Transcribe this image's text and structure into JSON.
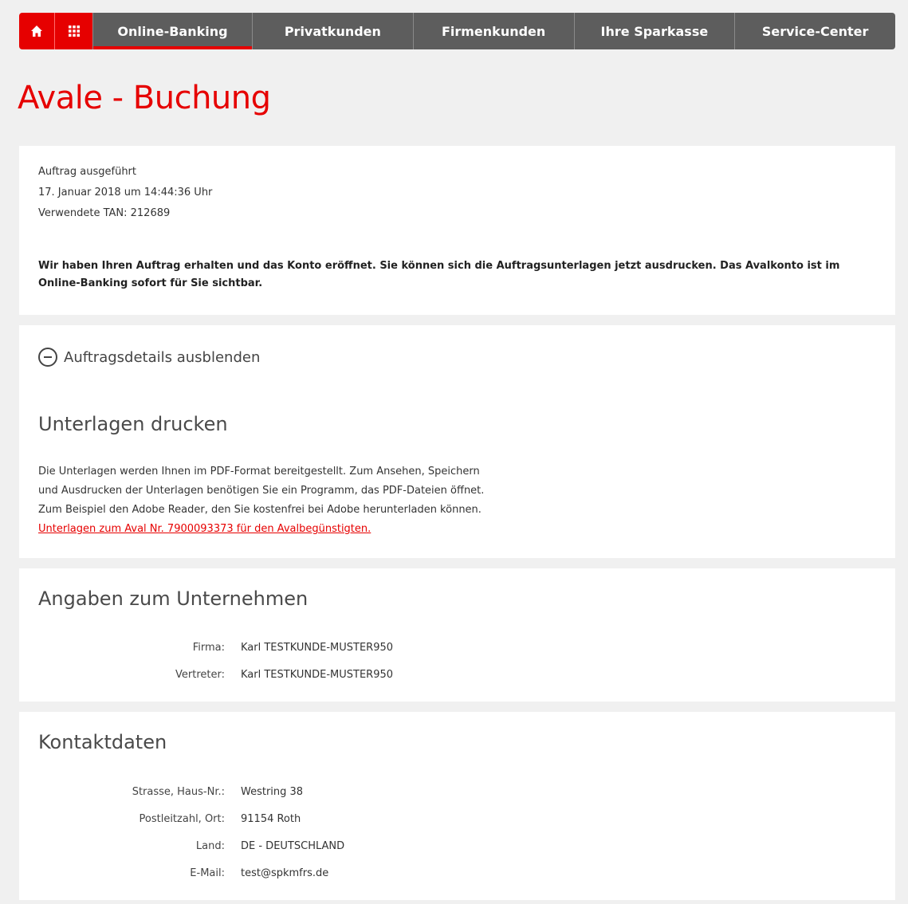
{
  "nav": {
    "home_icon": "home-icon",
    "grid_icon": "apps-grid-icon",
    "tabs": [
      "Online-Banking",
      "Privatkunden",
      "Firmenkunden",
      "Ihre Sparkasse",
      "Service-Center"
    ],
    "active_tab": "Online-Banking",
    "accent": "#e60000",
    "tab_bg": "#5d5d5d"
  },
  "page": {
    "title": "Avale - Buchung"
  },
  "status": {
    "line1": "Auftrag ausgeführt",
    "line2": "17. Januar 2018 um 14:44:36 Uhr",
    "line3": "Verwendete TAN: 212689",
    "notice": "Wir haben Ihren Auftrag erhalten und das Konto eröffnet. Sie können sich die Auftragsunterlagen jetzt ausdrucken. Das Avalkonto ist im Online-Banking sofort für Sie sichtbar."
  },
  "details": {
    "toggle_label": "Auftragsdetails ausblenden",
    "toggle_icon": "minus-circle-icon",
    "print_title": "Unterlagen drucken",
    "print_text_1": "Die Unterlagen werden Ihnen im PDF-Format bereitgestellt. Zum Ansehen, Speichern",
    "print_text_2": "und Ausdrucken der Unterlagen benötigen Sie ein Programm, das PDF-Dateien öffnet.",
    "print_text_3": "Zum Beispiel den Adobe Reader, den Sie kostenfrei bei Adobe herunterladen können.",
    "print_link": "Unterlagen zum Aval Nr. 7900093373 für den Avalbegünstigten."
  },
  "company": {
    "title": "Angaben zum Unternehmen",
    "rows": [
      {
        "label": "Firma:",
        "value": "Karl TESTKUNDE-MUSTER950"
      },
      {
        "label": "Vertreter:",
        "value": "Karl TESTKUNDE-MUSTER950"
      }
    ]
  },
  "contact": {
    "title": "Kontaktdaten",
    "rows": [
      {
        "label": "Strasse, Haus-Nr.:",
        "value": "Westring 38"
      },
      {
        "label": "Postleitzahl, Ort:",
        "value": "91154 Roth"
      },
      {
        "label": "Land:",
        "value": "DE - DEUTSCHLAND"
      },
      {
        "label": "E-Mail:",
        "value": "test@spkmfrs.de"
      }
    ]
  }
}
